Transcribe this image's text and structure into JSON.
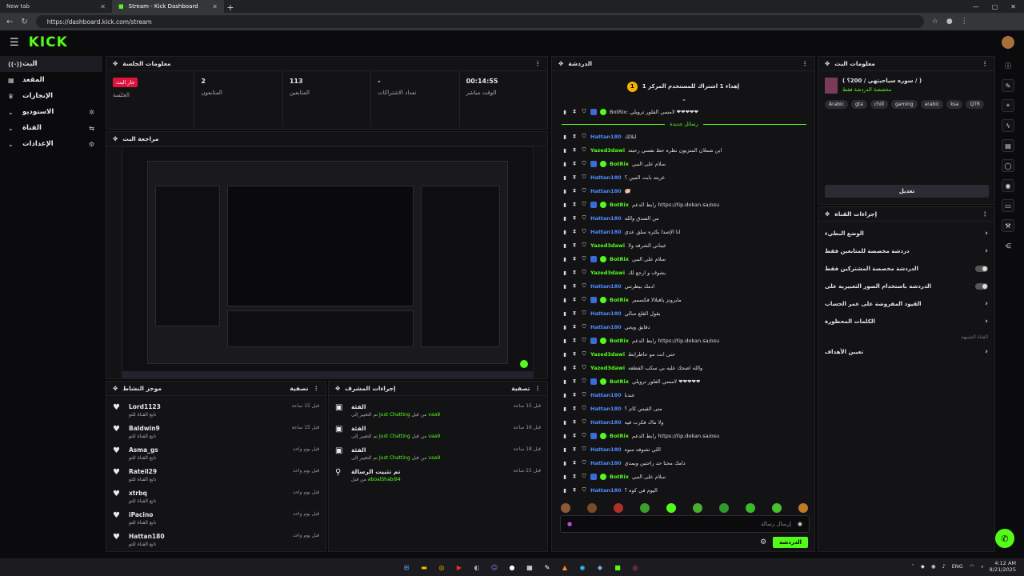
{
  "browser": {
    "tabs": [
      {
        "title": "New tab"
      },
      {
        "title": "Stream - Kick Dashboard"
      }
    ],
    "url": "https://dashboard.kick.com/stream"
  },
  "brand": {
    "logo": "KICK",
    "accent": "#53fc18"
  },
  "sidebar": {
    "items": [
      {
        "label": "البث",
        "icon": "broadcast-icon"
      },
      {
        "label": "المقعد",
        "icon": "dashboard-icon"
      },
      {
        "label": "الإنجازات",
        "icon": "trophy-icon"
      },
      {
        "label": "الاستوديو",
        "icon": "studio-icon"
      },
      {
        "label": "القناة",
        "icon": "channel-icon"
      },
      {
        "label": "الإعدادات",
        "icon": "gear-icon"
      }
    ]
  },
  "session": {
    "title": "معلومات الجلسة",
    "stats": [
      {
        "value": "جار البث",
        "label": "الجلسة"
      },
      {
        "value": "2",
        "label": "المتابعون"
      },
      {
        "value": "113",
        "label": "المتابعين"
      },
      {
        "value": "-",
        "label": "تعداد الاشتراكات"
      },
      {
        "value": "00:14:55",
        "label": "الوقت مباشر"
      }
    ]
  },
  "preview": {
    "title": "مراجعة البث"
  },
  "activity": {
    "title": "موجز النشاط",
    "filter": "تصفية",
    "items": [
      {
        "name": "Lord1123",
        "sub": "تابع القناة للتو",
        "time": "قبل 15 ساعة"
      },
      {
        "name": "Baldwin9",
        "sub": "تابع القناة للتو",
        "time": "قبل 15 ساعة"
      },
      {
        "name": "Asma_gs",
        "sub": "تابع القناة للتو",
        "time": "قبل يوم واحد"
      },
      {
        "name": "Rateil29",
        "sub": "تابع القناة للتو",
        "time": "قبل يوم واحد"
      },
      {
        "name": "xtrbq",
        "sub": "تابع القناة للتو",
        "time": "قبل يوم واحد"
      },
      {
        "name": "iPacino",
        "sub": "تابع القناة للتو",
        "time": "قبل يوم واحد"
      },
      {
        "name": "Hattan180",
        "sub": "تابع القناة للتو",
        "time": "قبل يوم واحد"
      }
    ]
  },
  "modactions": {
    "title": "إجراءات المشرف",
    "filter": "تصفية",
    "items": [
      {
        "title": "الفئة",
        "pre": "تم التغيير إلى ",
        "cat": "Just Chatting",
        "by": " من قبل ",
        "user": "vaa9",
        "time": "قبل 15 ساعة"
      },
      {
        "title": "الفئة",
        "pre": "تم التغيير إلى ",
        "cat": "Just Chatting",
        "by": " من قبل ",
        "user": "vaa9",
        "time": "قبل 16 ساعة"
      },
      {
        "title": "الفئة",
        "pre": "تم التغيير إلى ",
        "cat": "Just Chatting",
        "by": " من قبل ",
        "user": "vaa9",
        "time": "قبل 18 ساعة"
      },
      {
        "title": "تم تثبيت الرسالة",
        "pre": "من قبل ",
        "cat": "",
        "by": "",
        "user": "aboalShabi94",
        "time": "قبل 21 ساعة"
      }
    ]
  },
  "chat": {
    "title": "الدردشة",
    "pinned": "إهداء 1 اشتراك للمستخدم المركز 1",
    "pinned_rank": "1",
    "new_messages": "رسائل جديدة",
    "first_message": "BotRix: لامسي الفلور ترويلي ❤❤❤❤❤",
    "messages": [
      {
        "user": "Hattan180",
        "color": "#4d8dff",
        "text": "ابلالك",
        "badges": 0
      },
      {
        "user": "Yazed3dawi",
        "color": "#53fc18",
        "text": "ابن شملان المتزيون نظره حط نفسي رحبته",
        "badges": 0
      },
      {
        "user": "BotRix",
        "color": "#53fc18",
        "text": "سلام على النبي",
        "badges": 2
      },
      {
        "user": "Hattan180",
        "color": "#4d8dff",
        "text": "عربته بابت المين ؟",
        "badges": 0
      },
      {
        "user": "Hattan180",
        "color": "#4d8dff",
        "text": "🐖",
        "badges": 0
      },
      {
        "user": "BotRix",
        "color": "#53fc18",
        "text": "رابط الدعم https://tip.dokan.sa/osu",
        "badges": 2
      },
      {
        "user": "Hattan180",
        "color": "#4d8dff",
        "text": "من الصدق والله",
        "badges": 0
      },
      {
        "user": "Hattan180",
        "color": "#4d8dff",
        "text": "انا الإصدا بكثره سلق عدي",
        "badges": 0
      },
      {
        "user": "Yazed3dawi",
        "color": "#53fc18",
        "text": "عيناني الشرقه ولا",
        "badges": 0
      },
      {
        "user": "BotRix",
        "color": "#53fc18",
        "text": "سلام على النبي",
        "badges": 2
      },
      {
        "user": "Yazed3dawi",
        "color": "#53fc18",
        "text": "بشوف و ارجع لك",
        "badges": 0
      },
      {
        "user": "Hattan180",
        "color": "#4d8dff",
        "text": "ادمك ببطرتني",
        "badges": 0
      },
      {
        "user": "BotRix",
        "color": "#53fc18",
        "text": "مايرونز يافتلالا فكسمبر",
        "badges": 2
      },
      {
        "user": "Hattan180",
        "color": "#4d8dff",
        "text": "يقول القلع سالي",
        "badges": 0
      },
      {
        "user": "Hattan180",
        "color": "#4d8dff",
        "text": "دقايق ويجي",
        "badges": 0
      },
      {
        "user": "BotRix",
        "color": "#53fc18",
        "text": "رابط الدعم https://tip.dokan.sa/osu",
        "badges": 2
      },
      {
        "user": "Yazed3dawi",
        "color": "#53fc18",
        "text": "حتى انت مو حاطرابط",
        "badges": 0
      },
      {
        "user": "Yazed3dawi",
        "color": "#53fc18",
        "text": "والله اضحك عليه بي سكب القطعه",
        "badges": 0
      },
      {
        "user": "BotRix",
        "color": "#53fc18",
        "text": "لامسي الفلور ترويلي ❤❤❤❤❤",
        "badges": 2
      },
      {
        "user": "Hattan180",
        "color": "#4d8dff",
        "text": "عندنا",
        "badges": 0
      },
      {
        "user": "Hattan180",
        "color": "#4d8dff",
        "text": "متى القيس كام ؟",
        "badges": 0
      },
      {
        "user": "Hattan180",
        "color": "#4d8dff",
        "text": "ولا ماك فكرت فيه",
        "badges": 0
      },
      {
        "user": "BotRix",
        "color": "#53fc18",
        "text": "رابط الدعم https://tip.dokan.sa/osu",
        "badges": 2
      },
      {
        "user": "Hattan180",
        "color": "#4d8dff",
        "text": "اللي تشوفه سوه",
        "badges": 0
      },
      {
        "user": "Hattan180",
        "color": "#4d8dff",
        "text": "دامك محتا حد راحتين ويمدي",
        "badges": 0
      },
      {
        "user": "BotRix",
        "color": "#53fc18",
        "text": "سلام على النبي",
        "badges": 2
      },
      {
        "user": "Hattan180",
        "color": "#4d8dff",
        "text": "اليوم في كوه ؟",
        "badges": 0
      }
    ],
    "input_placeholder": "إرسال رسالة",
    "send_label": "الدردشة"
  },
  "stream_info": {
    "title": "معلومات البث",
    "stream_title": "( سوره سياحيتهي / 200؟ / )",
    "category": "مخصصة الدردشة فقط",
    "tags": [
      "Arabic",
      "gta",
      "chill",
      "gaming",
      "arabic",
      "ksa",
      "QTR"
    ],
    "edit_label": "تعديل"
  },
  "channel_actions": {
    "title": "إجراءات القناة",
    "rows": [
      {
        "label": "الوضع البطيء",
        "control": "chevron"
      },
      {
        "label": "دردشة مخصصة للمتابعين فقط",
        "control": "chevron"
      },
      {
        "label": "الدردشة مخصصة المشتركين فقط",
        "control": "toggle"
      },
      {
        "label": "الدردشة باستخدام الصور التعبيرية على",
        "control": "toggle"
      },
      {
        "label": "القيود المفروضة على عمر الحساب",
        "control": "chevron"
      },
      {
        "label": "الكلمات المحظورة",
        "control": "chevron"
      }
    ],
    "section_label": "القناة الشبيهة",
    "goals_label": "تعيين الأهداف"
  },
  "taskbar": {
    "lang": "ENG",
    "time": "4:12 AM",
    "date": "8/21/2025"
  }
}
